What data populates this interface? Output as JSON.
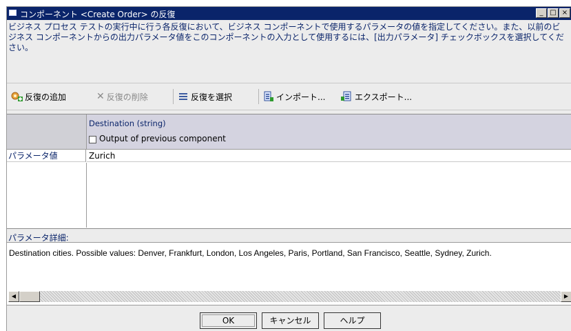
{
  "window": {
    "title": "コンポーネント <Create Order> の反復",
    "controls": {
      "minimize": "_",
      "maximize": "□",
      "close": "×"
    }
  },
  "description": "ビジネス プロセス テストの実行中に行う各反復において、ビジネス コンポーネントで使用するパラメータの値を指定してください。また、以前のビジネス コンポーネントからの出力パラメータ値をこのコンポーネントの入力として使用するには、[出力パラメータ] チェックボックスを選択してください。",
  "toolbar": {
    "add": "反復の追加",
    "delete": "反復の削除",
    "select": "反復を選択",
    "import": "インポート...",
    "export": "エクスポート..."
  },
  "grid": {
    "column": {
      "name": "Destination (string)",
      "checkbox_label": "Output of previous component",
      "checked": false
    },
    "rows": [
      {
        "header": "パラメータ値",
        "value": "Zurich"
      }
    ]
  },
  "details": {
    "label": "パラメータ詳細:",
    "text": "Destination cities. Possible values: Denver, Frankfurt, London, Los Angeles, Paris, Portland, San Francisco, Seattle, Sydney, Zurich."
  },
  "buttons": {
    "ok": "OK",
    "cancel": "キャンセル",
    "help": "ヘルプ"
  },
  "colors": {
    "titlebar": "#0a246a",
    "accent_text": "#0a246a",
    "column_header": "#d4d3e0"
  }
}
